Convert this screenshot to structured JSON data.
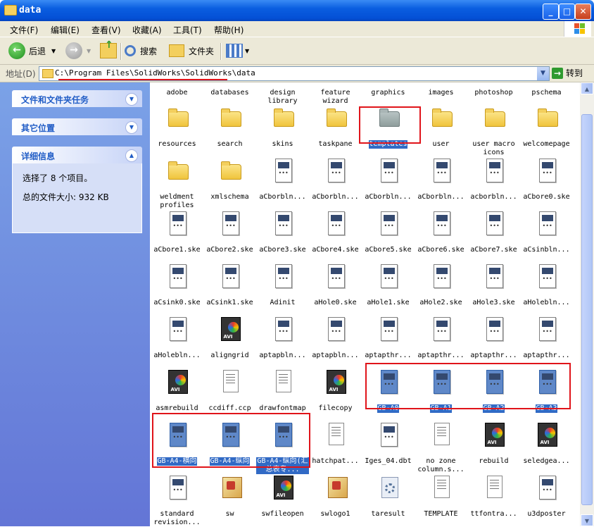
{
  "window": {
    "title": "data",
    "min": "_",
    "max": "□",
    "close": "✕"
  },
  "menu": [
    {
      "label": "文件(F)"
    },
    {
      "label": "编辑(E)"
    },
    {
      "label": "查看(V)"
    },
    {
      "label": "收藏(A)"
    },
    {
      "label": "工具(T)"
    },
    {
      "label": "帮助(H)"
    }
  ],
  "toolbar": {
    "back": "后退",
    "search": "搜索",
    "folders": "文件夹"
  },
  "address": {
    "label": "地址(D)",
    "path": "C:\\Program Files\\SolidWorks\\SolidWorks\\data",
    "go": "转到"
  },
  "sidebar": {
    "tasks_title": "文件和文件夹任务",
    "places_title": "其它位置",
    "details_title": "详细信息",
    "selected_text": "选择了 8 个项目。",
    "total_size": "总的文件大小: 932 KB"
  },
  "files": {
    "r0": [
      "adobe",
      "databases",
      "design library",
      "feature wizard",
      "graphics",
      "images",
      "photoshop",
      "pschema"
    ],
    "r1": [
      "resources",
      "search",
      "skins",
      "taskpane",
      "templates",
      "user",
      "user macro icons",
      "welcomepage"
    ],
    "r2": [
      "weldment profiles",
      "xmlschema",
      "aCborbln...",
      "aCborbln...",
      "aCborbln...",
      "aCborbln...",
      "acborbln...",
      "aCbore0.ske"
    ],
    "r3": [
      "aCbore1.ske",
      "aCbore2.ske",
      "aCbore3.ske",
      "aCbore4.ske",
      "aCbore5.ske",
      "aCbore6.ske",
      "aCbore7.ske",
      "aCsinbln..."
    ],
    "r4": [
      "aCsink0.ske",
      "aCsink1.ske",
      "Adinit",
      "aHole0.ske",
      "aHole1.ske",
      "aHole2.ske",
      "aHole3.ske",
      "aHolebln..."
    ],
    "r5": [
      "aHolebln...",
      "aligngrid",
      "aptapbln...",
      "aptapbln...",
      "aptapthr...",
      "aptapthr...",
      "aptapthr...",
      "aptapthr..."
    ],
    "r6": [
      "asmrebuild",
      "ccdiff.ccp",
      "drawfontmap",
      "filecopy",
      "GB-A0",
      "GB-A1",
      "GB-A2",
      "GB-A3"
    ],
    "r7": [
      "GB-A4-横向",
      "GB-A4-纵向",
      "GB-A4-纵向(汇总表专...",
      "hatchpat...",
      "Iges_04.dbt",
      "no zone column.s...",
      "rebuild",
      "seledgea..."
    ],
    "r8": [
      "standard revision...",
      "sw",
      "swfileopen",
      "swlogo1",
      "taresult",
      "TEMPLATE",
      "ttfontra...",
      "u3dposter"
    ]
  }
}
